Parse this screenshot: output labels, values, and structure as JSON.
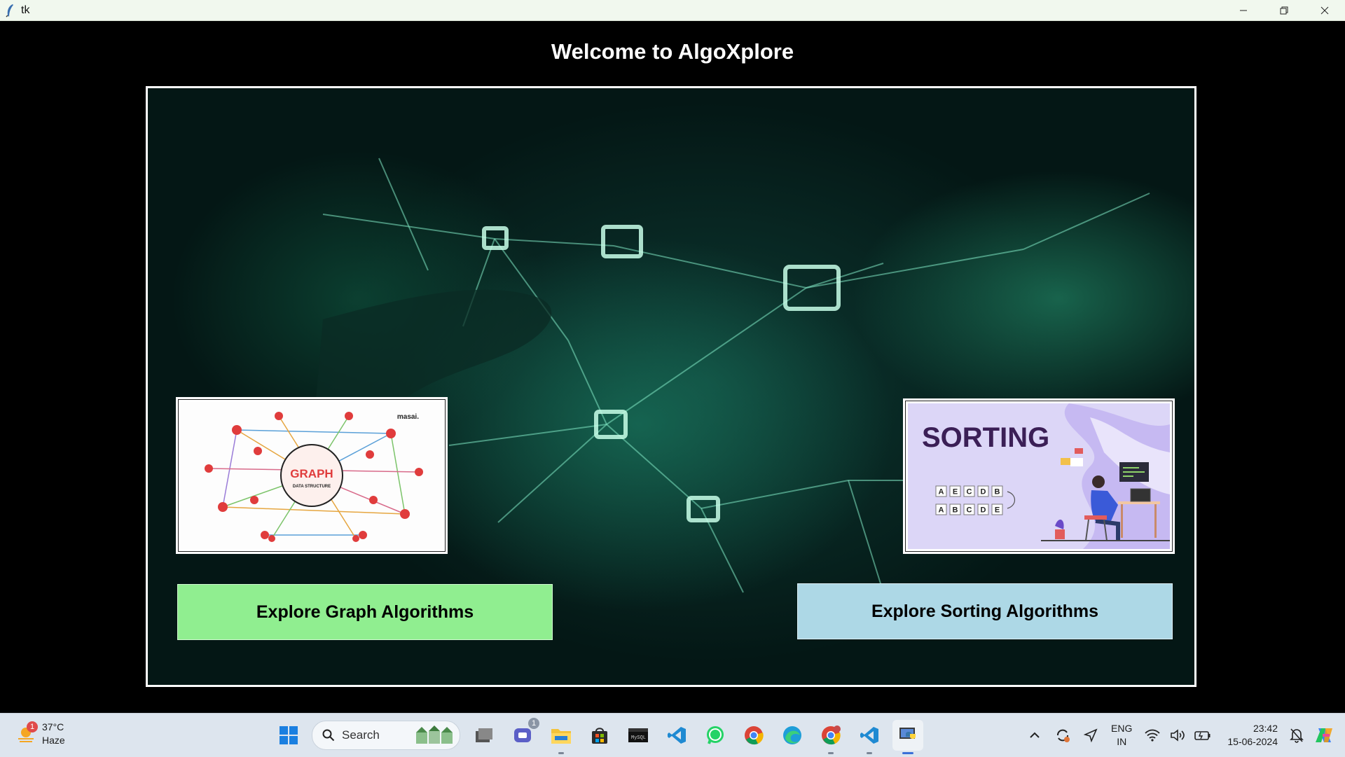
{
  "window": {
    "title": "tk",
    "controls": {
      "minimize": "—",
      "restore": "❐",
      "close": "✕"
    }
  },
  "app": {
    "heading": "Welcome to AlgoXplore",
    "graph_card": {
      "title": "GRAPH",
      "subtitle": "DATA STRUCTURE",
      "brand": "masai."
    },
    "sort_card": {
      "title": "SORTING",
      "row1": [
        "A",
        "E",
        "C",
        "D",
        "B"
      ],
      "row2": [
        "A",
        "B",
        "C",
        "D",
        "E"
      ]
    },
    "buttons": {
      "graph": "Explore Graph Algorithms",
      "sort": "Explore Sorting Algorithms"
    }
  },
  "taskbar": {
    "weather": {
      "temp": "37°C",
      "condition": "Haze",
      "badge": "1"
    },
    "search_label": "Search",
    "apps": [
      "start-icon",
      "task-view-icon",
      "teams-chat-icon",
      "file-explorer-icon",
      "microsoft-store-icon",
      "terminal-icon",
      "vscode-icon",
      "whatsapp-icon",
      "chrome-icon",
      "edge-icon",
      "chrome-profile-icon",
      "vscode-icon-2",
      "python-icon"
    ],
    "chat_badge": "1",
    "language": {
      "line1": "ENG",
      "line2": "IN"
    },
    "clock": {
      "time": "23:42",
      "date": "15-06-2024"
    }
  }
}
